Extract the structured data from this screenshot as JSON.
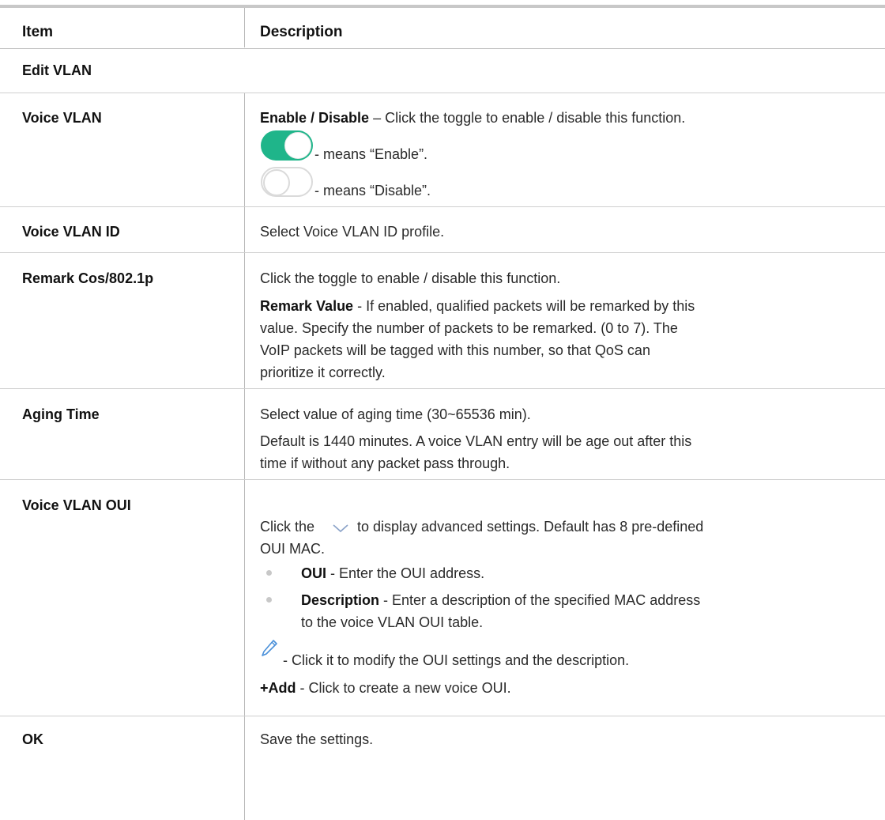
{
  "table": {
    "header": {
      "item": "Item",
      "description": "Description"
    },
    "section_title": "Edit VLAN",
    "rows": {
      "voice_vlan": {
        "item": "Voice VLAN",
        "line1_bold": "Enable / Disable",
        "line1_rest": " – Click the toggle to enable / disable this function.",
        "enable_note": "- means “Enable”.",
        "disable_note": "- means “Disable”."
      },
      "voice_vlan_id": {
        "item": "Voice VLAN ID",
        "desc": "Select Voice VLAN ID profile."
      },
      "remark_cos": {
        "item": "Remark Cos/802.1p",
        "line1": "Click the toggle to enable / disable this function.",
        "remark_bold": "Remark Value",
        "remark_rest_1": " - If enabled, qualified packets will be remarked by this",
        "remark_rest_2": "value. Specify the number of packets to be remarked. (0 to 7). The",
        "remark_rest_3": "VoIP packets will be tagged with this number, so that QoS can",
        "remark_rest_4": "prioritize it correctly."
      },
      "aging_time": {
        "item": "Aging Time",
        "line1": "Select value of aging time (30~65536 min).",
        "line2": "Default is 1440 minutes. A voice VLAN entry will be age out after this",
        "line3": "time if without any packet pass through."
      },
      "voice_vlan_oui": {
        "item": "Voice VLAN OUI",
        "click_the": "Click the",
        "click_rest": "to display advanced settings. Default has 8 pre-defined",
        "click_line2": "OUI MAC.",
        "oui_bold": "OUI",
        "oui_rest": " - Enter the OUI address.",
        "desc_bold": "Description",
        "desc_rest_1": " - Enter a description of the specified MAC address",
        "desc_rest_2": "to the voice VLAN OUI table.",
        "edit_note": "- Click it to modify the OUI settings and the description.",
        "add_bold": "+Add",
        "add_rest": " - Click to create a new voice OUI."
      },
      "ok": {
        "item": "OK",
        "desc": "Save the settings."
      }
    }
  },
  "icons": {
    "toggle_on": "toggle-on-icon",
    "toggle_off": "toggle-off-icon",
    "chevron": "chevron-down-icon",
    "edit": "pencil-icon"
  },
  "colors": {
    "toggle_on": "#1fb58a",
    "border": "#cfcfcf",
    "pencil": "#4a90d9"
  }
}
